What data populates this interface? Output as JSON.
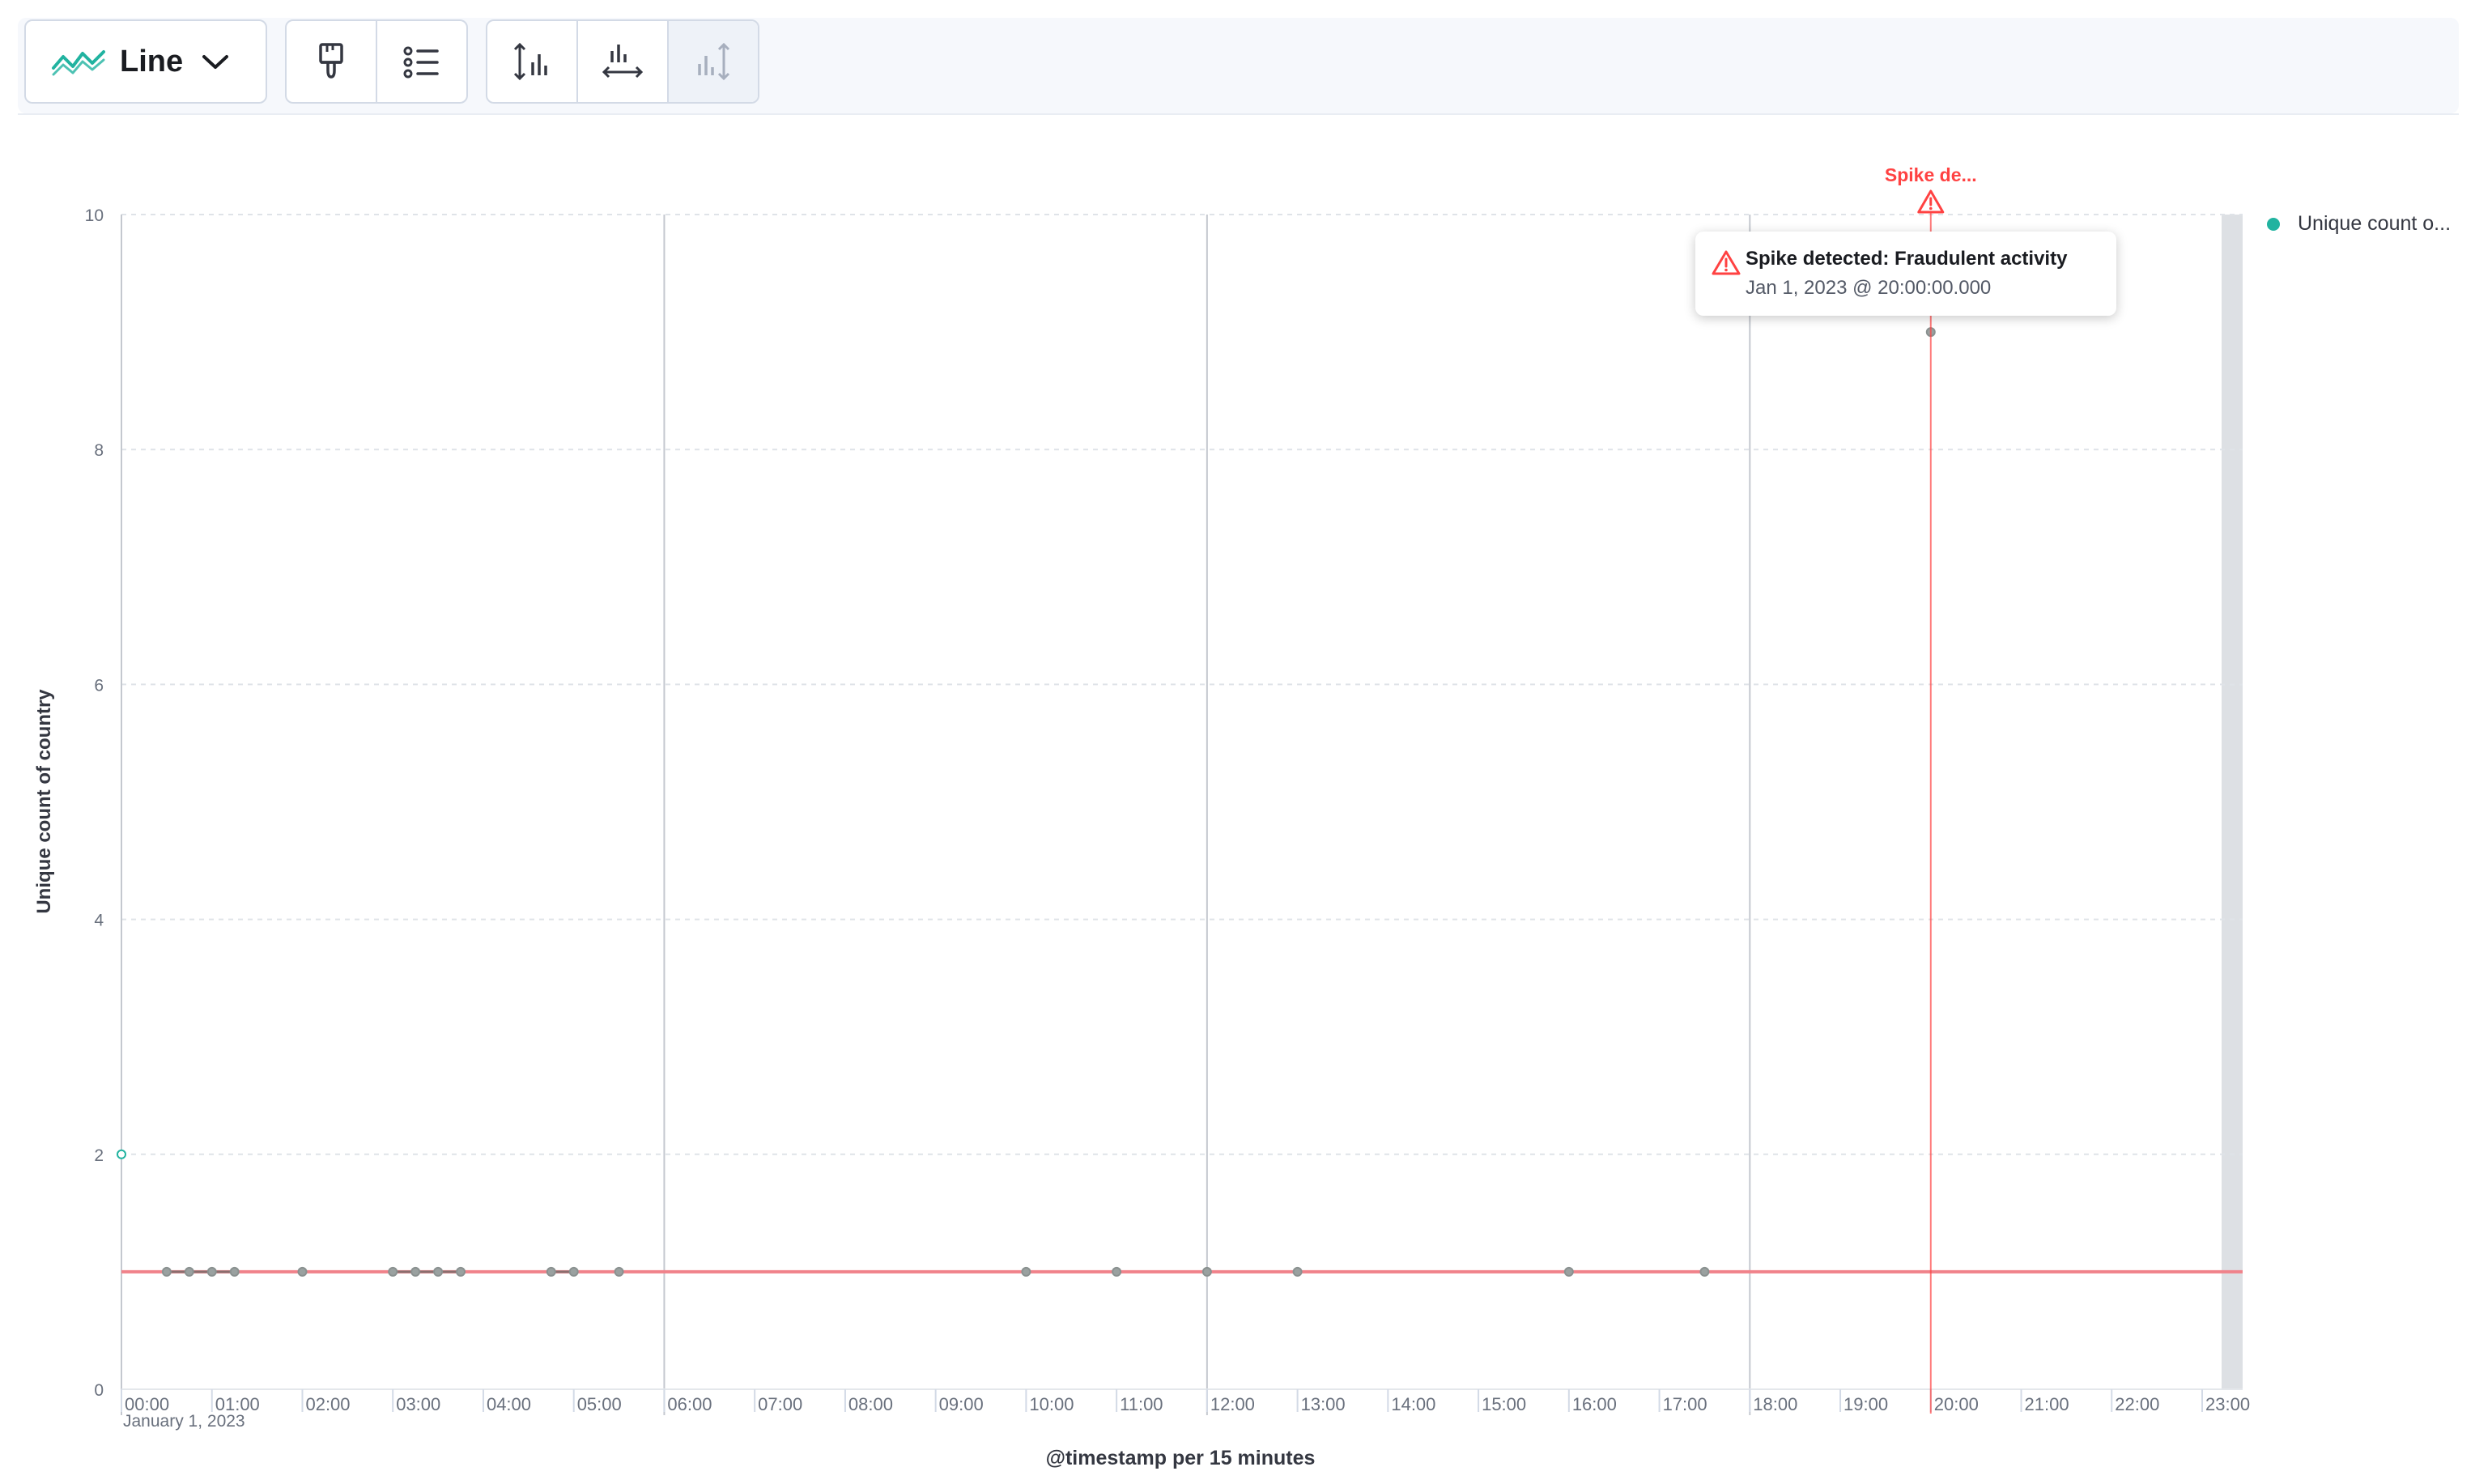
{
  "toolbar": {
    "chart_type_label": "Line",
    "icons": [
      "line-chart-icon",
      "chevron-down-icon",
      "paintbrush-icon",
      "list-settings-icon",
      "left-axis-icon",
      "bottom-axis-icon",
      "right-axis-icon"
    ]
  },
  "colors": {
    "series": "#21b3a0",
    "annotation": "#ff4242",
    "reference_line": "#f0828a",
    "gridline": "#c4c8cf",
    "end_band": "#dde0e4"
  },
  "annotation": {
    "label": "Spike de...",
    "tooltip_title": "Spike detected: Fraudulent activity",
    "tooltip_time": "Jan 1, 2023 @ 20:00:00.000"
  },
  "legend": {
    "position": "top-right",
    "entries": [
      {
        "label": "Unique count o..."
      }
    ]
  },
  "chart_data": {
    "type": "line",
    "ylabel": "Unique count of country",
    "xlabel": "@timestamp per 15 minutes",
    "ylim": [
      0,
      10
    ],
    "yticks": [
      "0",
      "2",
      "4",
      "6",
      "8",
      "10"
    ],
    "x_domain": [
      "00:00",
      "23:30"
    ],
    "x_ticks": [
      "00:00",
      "01:00",
      "02:00",
      "03:00",
      "04:00",
      "05:00",
      "06:00",
      "07:00",
      "08:00",
      "09:00",
      "10:00",
      "11:00",
      "12:00",
      "13:00",
      "14:00",
      "15:00",
      "16:00",
      "17:00",
      "18:00",
      "19:00",
      "20:00",
      "21:00",
      "22:00",
      "23:00"
    ],
    "x_date_label": "January 1, 2023",
    "grid": true,
    "series": [
      {
        "name": "Unique count o...",
        "points": [
          {
            "x": "00:00",
            "y": 2
          },
          {
            "x": "00:30",
            "y": 1
          },
          {
            "x": "00:45",
            "y": 1
          },
          {
            "x": "01:00",
            "y": 1
          },
          {
            "x": "01:15",
            "y": 1
          },
          {
            "x": "02:00",
            "y": 1
          },
          {
            "x": "03:00",
            "y": 1
          },
          {
            "x": "03:15",
            "y": 1
          },
          {
            "x": "03:30",
            "y": 1
          },
          {
            "x": "03:45",
            "y": 1
          },
          {
            "x": "04:45",
            "y": 1
          },
          {
            "x": "05:00",
            "y": 1
          },
          {
            "x": "05:30",
            "y": 1
          },
          {
            "x": "10:00",
            "y": 1
          },
          {
            "x": "11:00",
            "y": 1
          },
          {
            "x": "12:00",
            "y": 1
          },
          {
            "x": "13:00",
            "y": 1
          },
          {
            "x": "16:00",
            "y": 1
          },
          {
            "x": "17:30",
            "y": 1
          },
          {
            "x": "20:00",
            "y": 9
          }
        ]
      }
    ],
    "reference_lines": [
      {
        "y": 1
      }
    ],
    "marked_times": [
      "06:00",
      "12:00",
      "18:00"
    ],
    "annotation_time": "20:00"
  }
}
